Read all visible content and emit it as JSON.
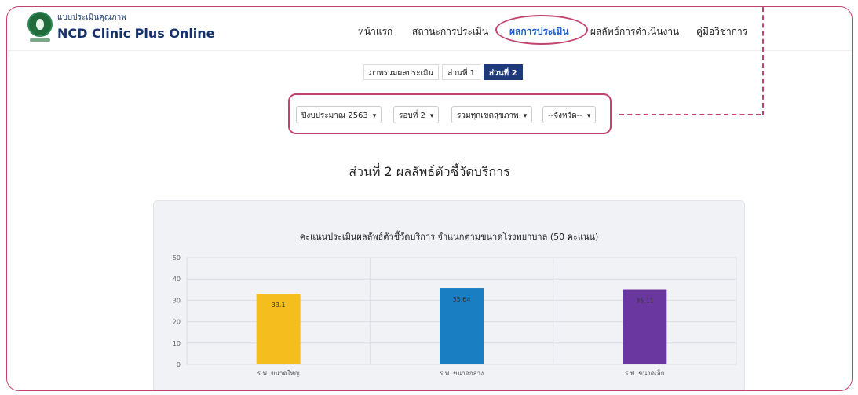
{
  "header": {
    "brand_small": "แบบประเมินคุณภาพ",
    "brand_name": "NCD Clinic Plus Online",
    "nav": [
      {
        "label": "หน้าแรก",
        "active": false
      },
      {
        "label": "สถานะการประเมิน",
        "active": false
      },
      {
        "label": "ผลการประเมิน",
        "active": true
      },
      {
        "label": "ผลลัพธ์การดำเนินงาน",
        "active": false
      },
      {
        "label": "คู่มือวิชาการ",
        "active": false
      }
    ]
  },
  "tabs": [
    {
      "label": "ภาพรวมผลประเมิน",
      "active": false
    },
    {
      "label": "ส่วนที่ 1",
      "active": false
    },
    {
      "label": "ส่วนที่ 2",
      "active": true
    }
  ],
  "filters": [
    {
      "value": "ปีงบประมาณ 2563"
    },
    {
      "value": "รอบที่ 2"
    },
    {
      "value": "รวมทุกเขตสุขภาพ"
    },
    {
      "value": "--จังหวัด--"
    }
  ],
  "page_title": "ส่วนที่ 2 ผลลัพธ์ตัวชี้วัดบริการ",
  "colors": {
    "accent": "#c2446e",
    "nav_active": "#1f61c9",
    "tab_active": "#1f3a7a"
  },
  "chart_data": {
    "type": "bar",
    "title": "คะแนนประเมินผลลัพธ์ตัวชี้วัดบริการ จำแนกตามขนาดโรงพยาบาล (50 คะแนน)",
    "categories": [
      "ร.พ. ขนาดใหญ่",
      "ร.พ. ขนาดกลาง",
      "ร.พ. ขนาดเล็ก"
    ],
    "values": [
      33.1,
      35.64,
      35.11
    ],
    "value_labels": [
      "33.1",
      "35.64",
      "35.11"
    ],
    "colors": [
      "#f6bd1e",
      "#1a7ec3",
      "#6a37a0"
    ],
    "yticks": [
      "50",
      "40",
      "30",
      "20",
      "10",
      "0"
    ],
    "ylim": [
      0,
      50
    ],
    "grid": true
  }
}
